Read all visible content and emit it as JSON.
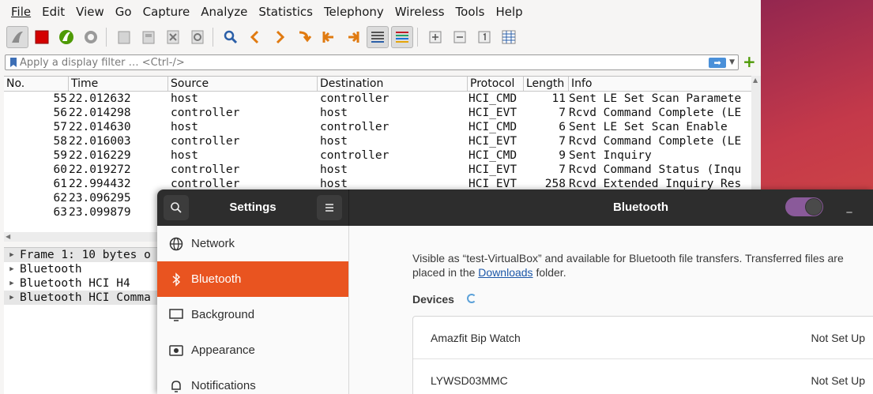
{
  "wireshark": {
    "menu": [
      "File",
      "Edit",
      "View",
      "Go",
      "Capture",
      "Analyze",
      "Statistics",
      "Telephony",
      "Wireless",
      "Tools",
      "Help"
    ],
    "toolbar_icons": [
      "shark-fin-start-icon",
      "stop-capture-icon",
      "restart-capture-icon",
      "capture-options-icon",
      "open-file-icon",
      "save-file-icon",
      "close-file-icon",
      "reload-file-icon",
      "find-packet-icon",
      "go-back-icon",
      "go-forward-icon",
      "go-to-packet-icon",
      "go-first-icon",
      "go-last-icon",
      "autoscroll-icon",
      "colorize-icon",
      "zoom-in-icon",
      "zoom-out-icon",
      "normal-size-icon",
      "resize-columns-icon"
    ],
    "filter": {
      "placeholder": "Apply a display filter … <Ctrl-/>"
    },
    "columns": {
      "no": "No.",
      "time": "Time",
      "source": "Source",
      "destination": "Destination",
      "protocol": "Protocol",
      "length": "Length",
      "info": "Info"
    },
    "packets": [
      {
        "no": "55",
        "time": "22.012632",
        "source": "host",
        "destination": "controller",
        "protocol": "HCI_CMD",
        "length": "11",
        "info": "Sent LE Set Scan Paramete"
      },
      {
        "no": "56",
        "time": "22.014298",
        "source": "controller",
        "destination": "host",
        "protocol": "HCI_EVT",
        "length": "7",
        "info": "Rcvd Command Complete (LE"
      },
      {
        "no": "57",
        "time": "22.014630",
        "source": "host",
        "destination": "controller",
        "protocol": "HCI_CMD",
        "length": "6",
        "info": "Sent LE Set Scan Enable"
      },
      {
        "no": "58",
        "time": "22.016003",
        "source": "controller",
        "destination": "host",
        "protocol": "HCI_EVT",
        "length": "7",
        "info": "Rcvd Command Complete (LE"
      },
      {
        "no": "59",
        "time": "22.016229",
        "source": "host",
        "destination": "controller",
        "protocol": "HCI_CMD",
        "length": "9",
        "info": "Sent Inquiry"
      },
      {
        "no": "60",
        "time": "22.019272",
        "source": "controller",
        "destination": "host",
        "protocol": "HCI_EVT",
        "length": "7",
        "info": "Rcvd Command Status (Inqu"
      },
      {
        "no": "61",
        "time": "22.994432",
        "source": "controller",
        "destination": "host",
        "protocol": "HCI_EVT",
        "length": "258",
        "info": "Rcvd Extended Inquiry Res"
      },
      {
        "no": "62",
        "time": "23.096295",
        "source": "",
        "destination": "",
        "protocol": "",
        "length": "",
        "info": ""
      },
      {
        "no": "63",
        "time": "23.099879",
        "source": "",
        "destination": "",
        "protocol": "",
        "length": "",
        "info": ""
      }
    ],
    "details": [
      {
        "label": "Frame 1: 10 bytes o"
      },
      {
        "label": "Bluetooth"
      },
      {
        "label": "Bluetooth HCI H4"
      },
      {
        "label": "Bluetooth HCI Comma"
      }
    ]
  },
  "settings": {
    "title": "Settings",
    "panel_title": "Bluetooth",
    "bluetooth_enabled": true,
    "nav": [
      {
        "label": "Network",
        "icon": "network-icon"
      },
      {
        "label": "Bluetooth",
        "icon": "bluetooth-icon",
        "active": true
      },
      {
        "label": "Background",
        "icon": "background-icon"
      },
      {
        "label": "Appearance",
        "icon": "appearance-icon"
      },
      {
        "label": "Notifications",
        "icon": "notifications-icon"
      }
    ],
    "description_part1": "Visible as “test-VirtualBox” and available for Bluetooth file transfers. Transferred files are placed in the ",
    "downloads_link": "Downloads",
    "description_part2": " folder.",
    "devices_label": "Devices",
    "devices": [
      {
        "name": "Amazfit Bip Watch",
        "status": "Not Set Up"
      },
      {
        "name": "LYWSD03MMC",
        "status": "Not Set Up"
      }
    ],
    "accent_color": "#e95420"
  }
}
